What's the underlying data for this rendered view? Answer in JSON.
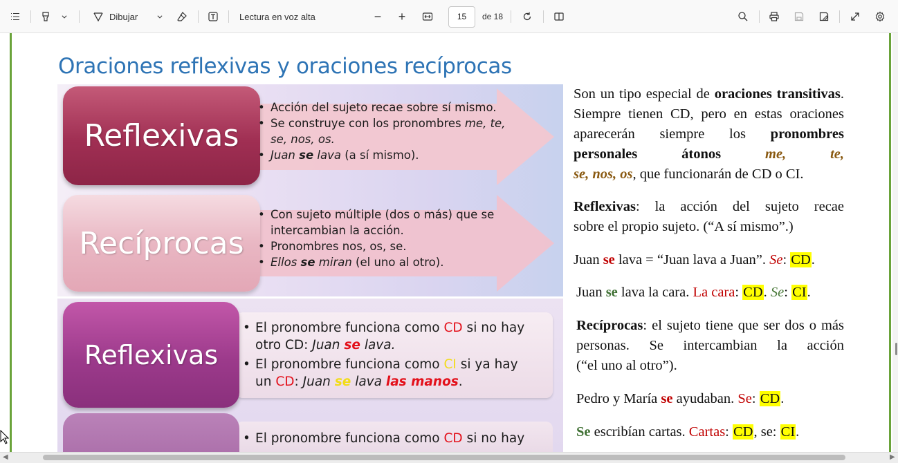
{
  "toolbar": {
    "draw_label": "Dibujar",
    "read_aloud_label": "Lectura en voz alta",
    "page_current": "15",
    "page_total": "de 18",
    "zoom_out": "−",
    "zoom_in": "+"
  },
  "slide": {
    "title": "Oraciones reflexivas y oraciones recíprocas",
    "panel1": {
      "reflexivas_title": "Reflexivas",
      "reciprocas_title": "Recíprocas",
      "reflexivas_b1": "Acción del sujeto recae sobre sí mismo.",
      "reflexivas_b2a": "Se construye con los pronombres ",
      "reflexivas_b2b": "me, te,",
      "reflexivas_b2c": "se, nos, os.",
      "reflexivas_b3a": "Juan ",
      "reflexivas_b3b": "se",
      "reflexivas_b3c": " lava",
      "reflexivas_b3d": " (a sí mismo).",
      "reciprocas_b1a": "Con sujeto múltiple (dos o más) que se",
      "reciprocas_b1b": "intercambian la acción.",
      "reciprocas_b2": "Pronombres nos, os, se.",
      "reciprocas_b3a": "Ellos ",
      "reciprocas_b3b": "se",
      "reciprocas_b3c": " miran",
      "reciprocas_b3d": " (el uno al otro)."
    },
    "panel2": {
      "reflexivas_title": "Reflexivas",
      "b1a": "El pronombre funciona como ",
      "b1b": "CD",
      "b1c": " si no hay",
      "b1d": "otro CD: ",
      "b1e": "Juan ",
      "b1f": "se",
      "b1g": " lava.",
      "b2a": "El pronombre funciona como ",
      "b2b": "CI",
      "b2c": " si ya hay",
      "b2d": "un ",
      "b2e": "CD",
      "b2f": ": ",
      "b2g": "Juan ",
      "b2h": "se",
      "b2i": " lava ",
      "b2j": "las manos",
      "b2k": ".",
      "b3a": "El pronombre funciona como ",
      "b3b": "CD",
      "b3c": " si no hay"
    }
  },
  "right": {
    "p1": {
      "a": "Son un tipo especial de ",
      "b": "oraciones",
      "c": "transitivas",
      "d": ". Siempre tienen CD, pero en",
      "e": "estas oraciones aparecerán siempre los",
      "f": "pronombres personales átonos",
      "g": "me, te,",
      "h": "se, nos, os",
      "i": ", que funcionarán de CD o CI."
    },
    "p2": {
      "a": "Reflexivas",
      "b": ": la acción del sujeto recae",
      "c": "sobre el propio sujeto. (“A sí mismo”.)"
    },
    "ex1": {
      "a": "Juan ",
      "b": "se",
      "c": " lava = “Juan lava a Juan”. ",
      "d": "Se",
      "e": ": ",
      "f": "CD",
      "g": "."
    },
    "ex2": {
      "a": "Juan ",
      "b": "se",
      "c": " lava la cara. ",
      "d": "La cara",
      "e": ": ",
      "f": "CD",
      "g": ". ",
      "h": "Se",
      "i": ": ",
      "j": "CI",
      "k": "."
    },
    "p3": {
      "a": "Recíprocas",
      "b": ": el sujeto tiene que ser dos o",
      "c": "más personas. Se intercambian la acción",
      "d": "(“el uno al otro”)."
    },
    "ex3": {
      "a": "Pedro y María ",
      "b": "se",
      "c": " ayudaban. ",
      "d": "Se",
      "e": ": ",
      "f": "CD",
      "g": "."
    },
    "ex4": {
      "a": "Se",
      "b": " escribían cartas. ",
      "c": "Cartas",
      "d": ": ",
      "e": "CD",
      "f": ", se: ",
      "g": "CI",
      "h": "."
    }
  },
  "colors": {
    "title_blue": "#2e74b5",
    "page_border_green": "#6aa33a",
    "highlight_yellow": "#ffff00",
    "text_red": "#c00000",
    "pronoun_brown": "#8a5a12"
  }
}
